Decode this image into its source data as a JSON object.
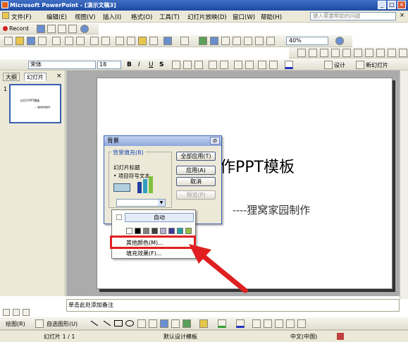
{
  "window": {
    "title": "Microsoft PowerPoint - [演示文稿3]",
    "controls": [
      "_",
      "□",
      "×"
    ]
  },
  "menubar": {
    "items": [
      "文件(F)",
      "编辑(E)",
      "视图(V)",
      "插入(I)",
      "格式(O)",
      "工具(T)",
      "幻灯片放映(D)",
      "窗口(W)",
      "帮助(H)"
    ],
    "help_placeholder": "键入需要帮助的问题",
    "close": "×"
  },
  "toolbar1": {
    "record_label": "Record"
  },
  "toolbar2": {
    "zoom": "40%"
  },
  "format_toolbar": {
    "font": "宋体",
    "size": "18",
    "bold": "B",
    "italic": "I",
    "underline": "U",
    "shadow": "S",
    "design_label": "设计",
    "new_slide_label": "新幻灯片"
  },
  "left_panel": {
    "tabs": [
      "大纲",
      "幻灯片"
    ],
    "close": "×",
    "slide_number": "1",
    "thumb_title": "幻灯片PPT模板",
    "thumb_subtitle": "----狸窝家园制作"
  },
  "slide": {
    "title": "作PPT模板",
    "subtitle": "----狸窝家园制作"
  },
  "dialog": {
    "title": "背景",
    "group_label": "背景填充(B)",
    "preview_title": "幻灯片标题",
    "preview_bullet": "• 项目符号文本",
    "buttons": [
      "全部应用(T)",
      "应用(A)",
      "取消",
      "预览(P)"
    ]
  },
  "color_menu": {
    "auto": "自动",
    "swatches": [
      "#ffffff",
      "#000000",
      "#808080",
      "#404040",
      "#b0b0d0",
      "#3a3a9a",
      "#20a0a0",
      "#90c040"
    ],
    "more_colors": "其他颜色(M)...",
    "fill_effects": "填充效果(F)..."
  },
  "notes": {
    "placeholder": "单击此处添加备注"
  },
  "draw_toolbar": {
    "draw_label": "绘图(R)",
    "autoshape_label": "自选图形(U)"
  },
  "statusbar": {
    "slide_info": "幻灯片 1 / 1",
    "template": "默认设计模板",
    "language": "中文(中国)"
  }
}
